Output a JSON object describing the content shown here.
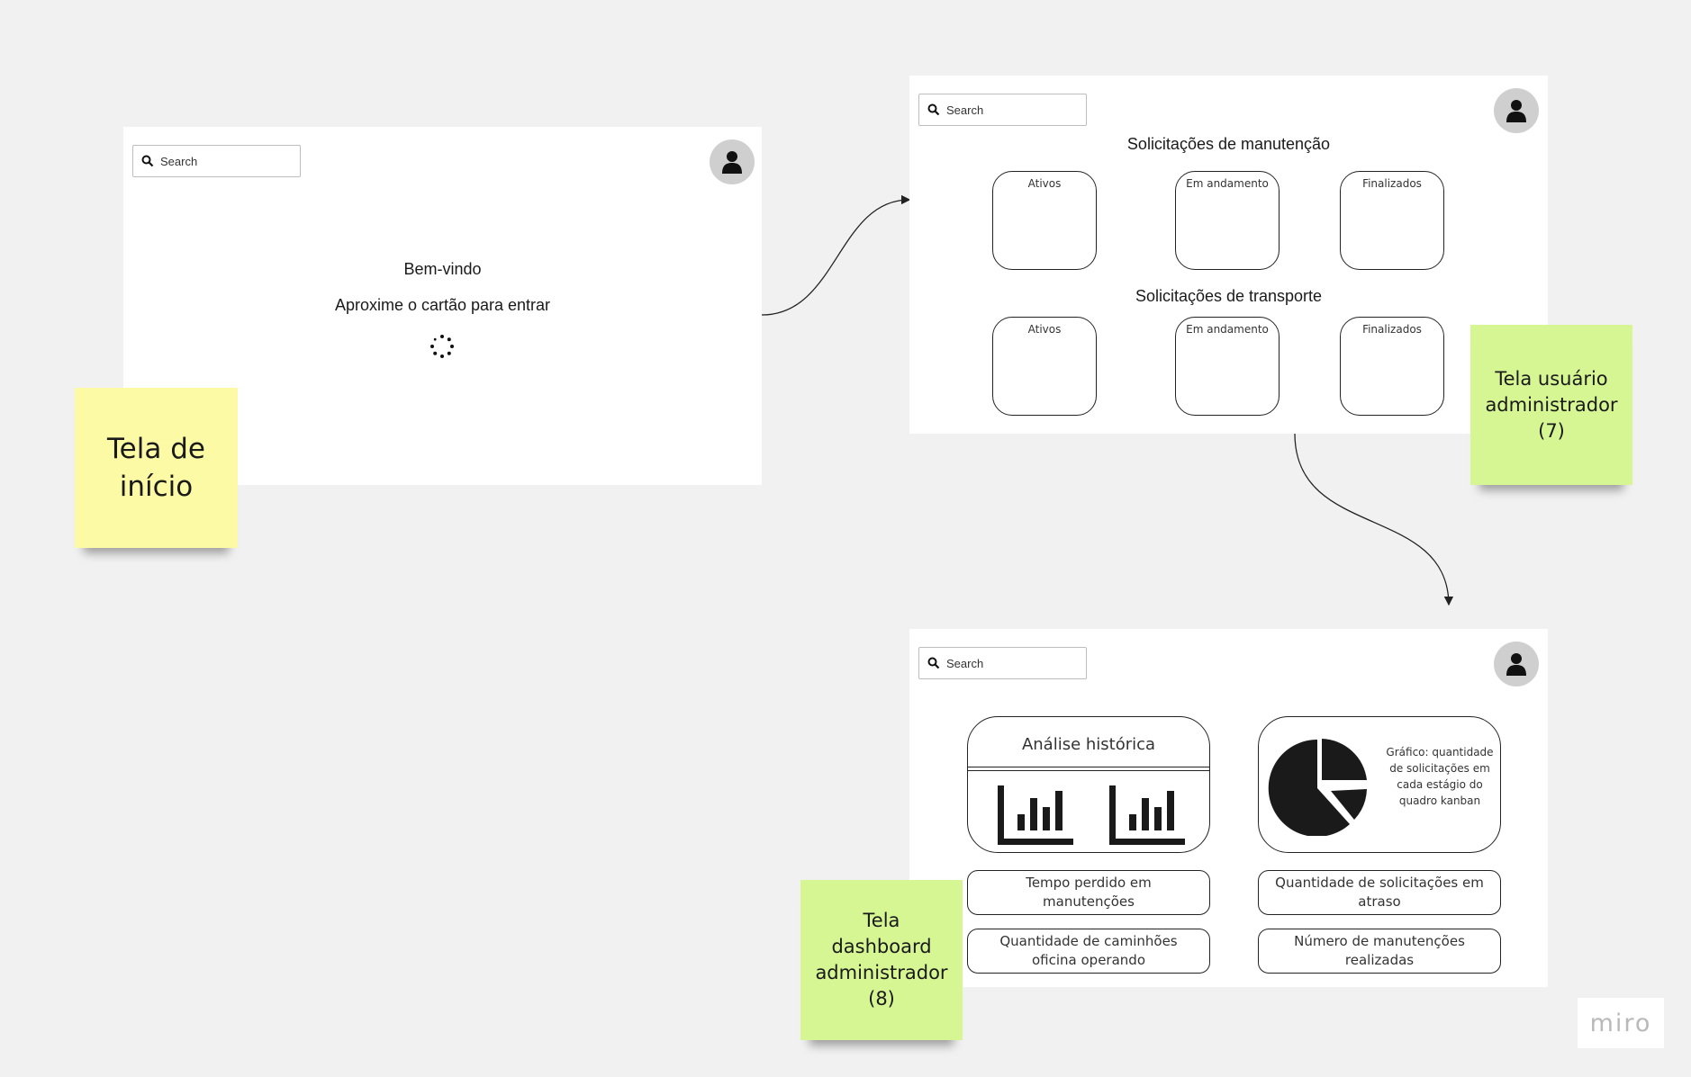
{
  "start_screen": {
    "search_placeholder": "Search",
    "title": "Bem-vindo",
    "subtitle": "Aproxime o cartão para entrar"
  },
  "admin_screen": {
    "search_placeholder": "Search",
    "maintenance_title": "Solicitações de manutenção",
    "transport_title": "Solicitações de transporte",
    "maintenance_cards": [
      "Ativos",
      "Em andamento",
      "Finalizados"
    ],
    "transport_cards": [
      "Ativos",
      "Em andamento",
      "Finalizados"
    ]
  },
  "dashboard_screen": {
    "search_placeholder": "Search",
    "history_title": "Análise histórica",
    "pie_caption": "Gráfico: quantidade de solicitações em cada estágio do quadro kanban",
    "metrics": [
      "Tempo perdido em manutenções",
      "Quantidade de solicitações em atraso",
      "Quantidade de caminhões oficina operando",
      "Número de manutenções realizadas"
    ]
  },
  "sticky_notes": [
    {
      "text": "Tela de\ninício",
      "color": "#fdfaa5"
    },
    {
      "text": "Tela usuário\nadministrador\n(7)",
      "color": "#d6f693"
    },
    {
      "text": "Tela\ndashboard\nadministrador\n(8)",
      "color": "#d6f693"
    }
  ],
  "watermark": "miro",
  "icons": [
    "search-icon",
    "user-icon",
    "loading-spinner-icon",
    "bar-chart-icon",
    "pie-chart-icon"
  ]
}
